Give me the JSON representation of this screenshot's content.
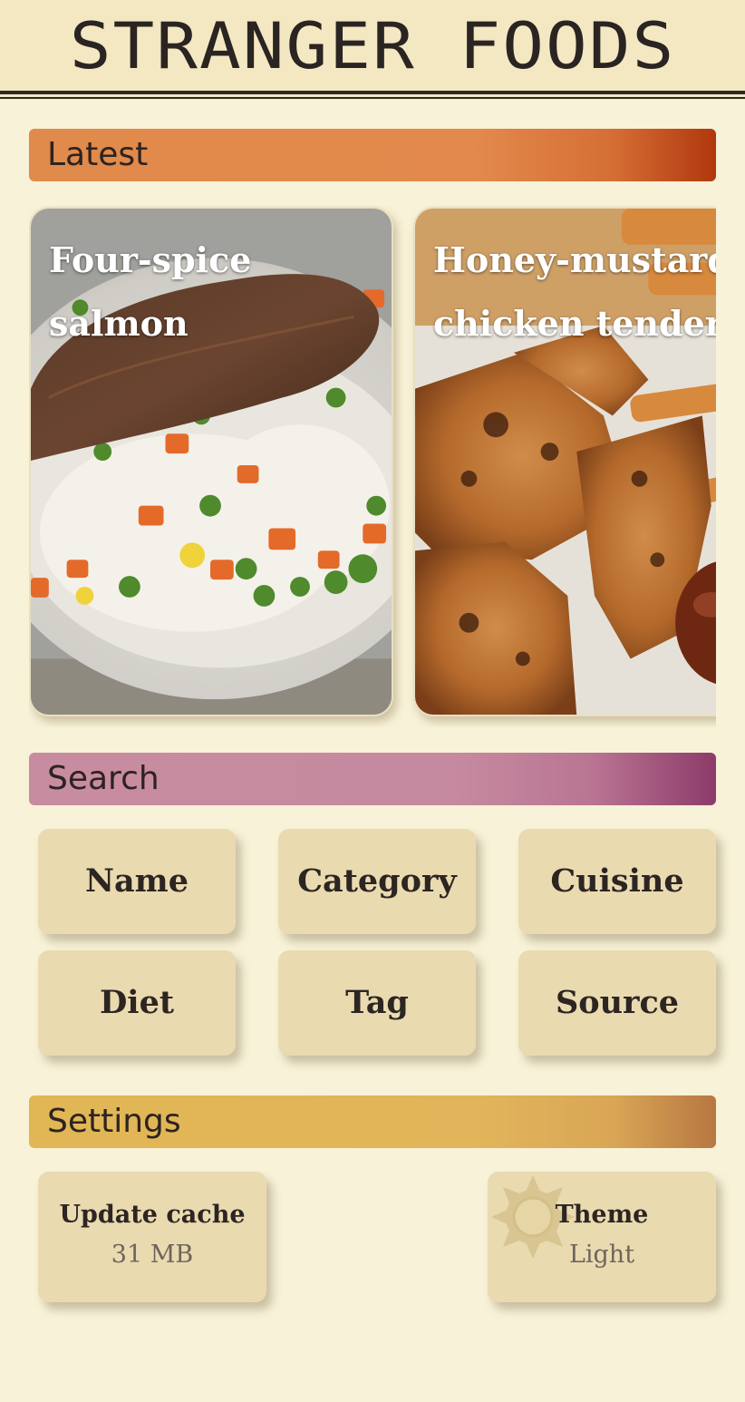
{
  "header": {
    "title": "STRANGER FOODS"
  },
  "sections": {
    "latest": "Latest",
    "search": "Search",
    "settings": "Settings"
  },
  "latest": {
    "cards": [
      {
        "title": "Four-spice\nsalmon"
      },
      {
        "title": "Honey-mustard\nchicken tenders"
      }
    ]
  },
  "search": {
    "buttons": [
      "Name",
      "Category",
      "Cuisine",
      "Diet",
      "Tag",
      "Source"
    ]
  },
  "settings": {
    "update_cache": {
      "label": "Update cache",
      "value": "31 MB"
    },
    "theme": {
      "label": "Theme",
      "value": "Light",
      "icon": "sun-icon"
    }
  },
  "colors": {
    "background": "#f8f2d8",
    "header": "#f4e8c3",
    "latest_bar": "#e08a4b",
    "search_bar": "#c88ca0",
    "settings_bar": "#e1b655",
    "tile": "#eadab0"
  }
}
